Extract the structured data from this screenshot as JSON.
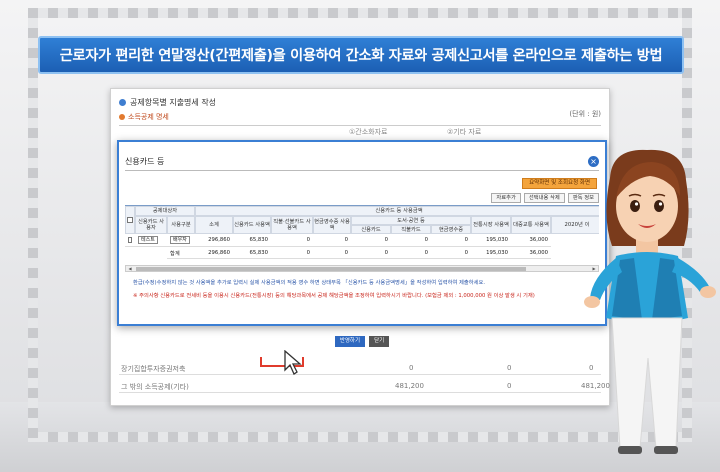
{
  "banner": {
    "title": "근로자가 편리한 연말정산(간편제출)을 이용하여 간소화 자료와 공제신고서를 온라인으로 제출하는 방법"
  },
  "page": {
    "title": "공제항목별 지출명세 작성",
    "unit": "(단위 : 원)",
    "subtitle": "소득공제 명세",
    "header_cols": [
      "①간소화자료",
      "②기타 자료"
    ],
    "rows": [
      {
        "label": "장기집합투자증권저축",
        "v1": "0",
        "v2": "0",
        "v3": "0"
      },
      {
        "label": "그 밖의 소득공제(기타)",
        "v1": "481,200",
        "v2": "0",
        "v3": "481,200"
      }
    ]
  },
  "dialog": {
    "title": "신용카드 등",
    "close": "×",
    "orange_button": "요약화면 및 조회요청 화면",
    "buttons": [
      "자료추가",
      "선택내용 삭제",
      "판독 정보"
    ],
    "grid_headers": {
      "checkbox_col": "",
      "subject": "공제대상자",
      "name": "신용카드 사용자",
      "relation": "사용구분",
      "total": "소계",
      "credit": "신용카드 사용액",
      "debit": "직불·선불카드 사용액",
      "cash": "현금영수증 사용액",
      "group": "신용카드 등 사용금액",
      "market_group": "도서·공연 등",
      "market_credit": "신용카드",
      "market_debit": "직불카드",
      "market_cash": "현금영수증",
      "traditional": "전통시장 사용액",
      "transit": "대중교통 사용액",
      "year": "2020년 이"
    },
    "grid_rows": [
      {
        "name": "테스트",
        "relation": "배우자",
        "total": "296,860",
        "credit": "65,830",
        "debit": "0",
        "cash": "0",
        "mc": "0",
        "md": "0",
        "mcash": "0",
        "traditional": "195,030",
        "transit": "36,000"
      },
      {
        "name": "",
        "relation": "합계",
        "total": "296,860",
        "credit": "65,830",
        "debit": "0",
        "cash": "0",
        "mc": "0",
        "md": "0",
        "mcash": "0",
        "traditional": "195,030",
        "transit": "36,000"
      }
    ],
    "note_blue": "환급(수정)수정하지 않는 것 사용액을 추가로 입력시 실제 사용금액의 적용 영수 하면 상태무목 「신용카드 등 사용금액명세」을 작성하여 입력하여 제출하세요.",
    "note_red": "※ 주의사항 신용카드로 전세비 등을 이용시 신용카드(전통시장) 등의 해당과목에서 공제 해당금액을 조정하여 입력하시기 바랍니다. (보험금 제외 : 1,000,000 원 이상 발생 시 기재)",
    "confirm_button": "반영하기",
    "close_button": "닫기"
  }
}
